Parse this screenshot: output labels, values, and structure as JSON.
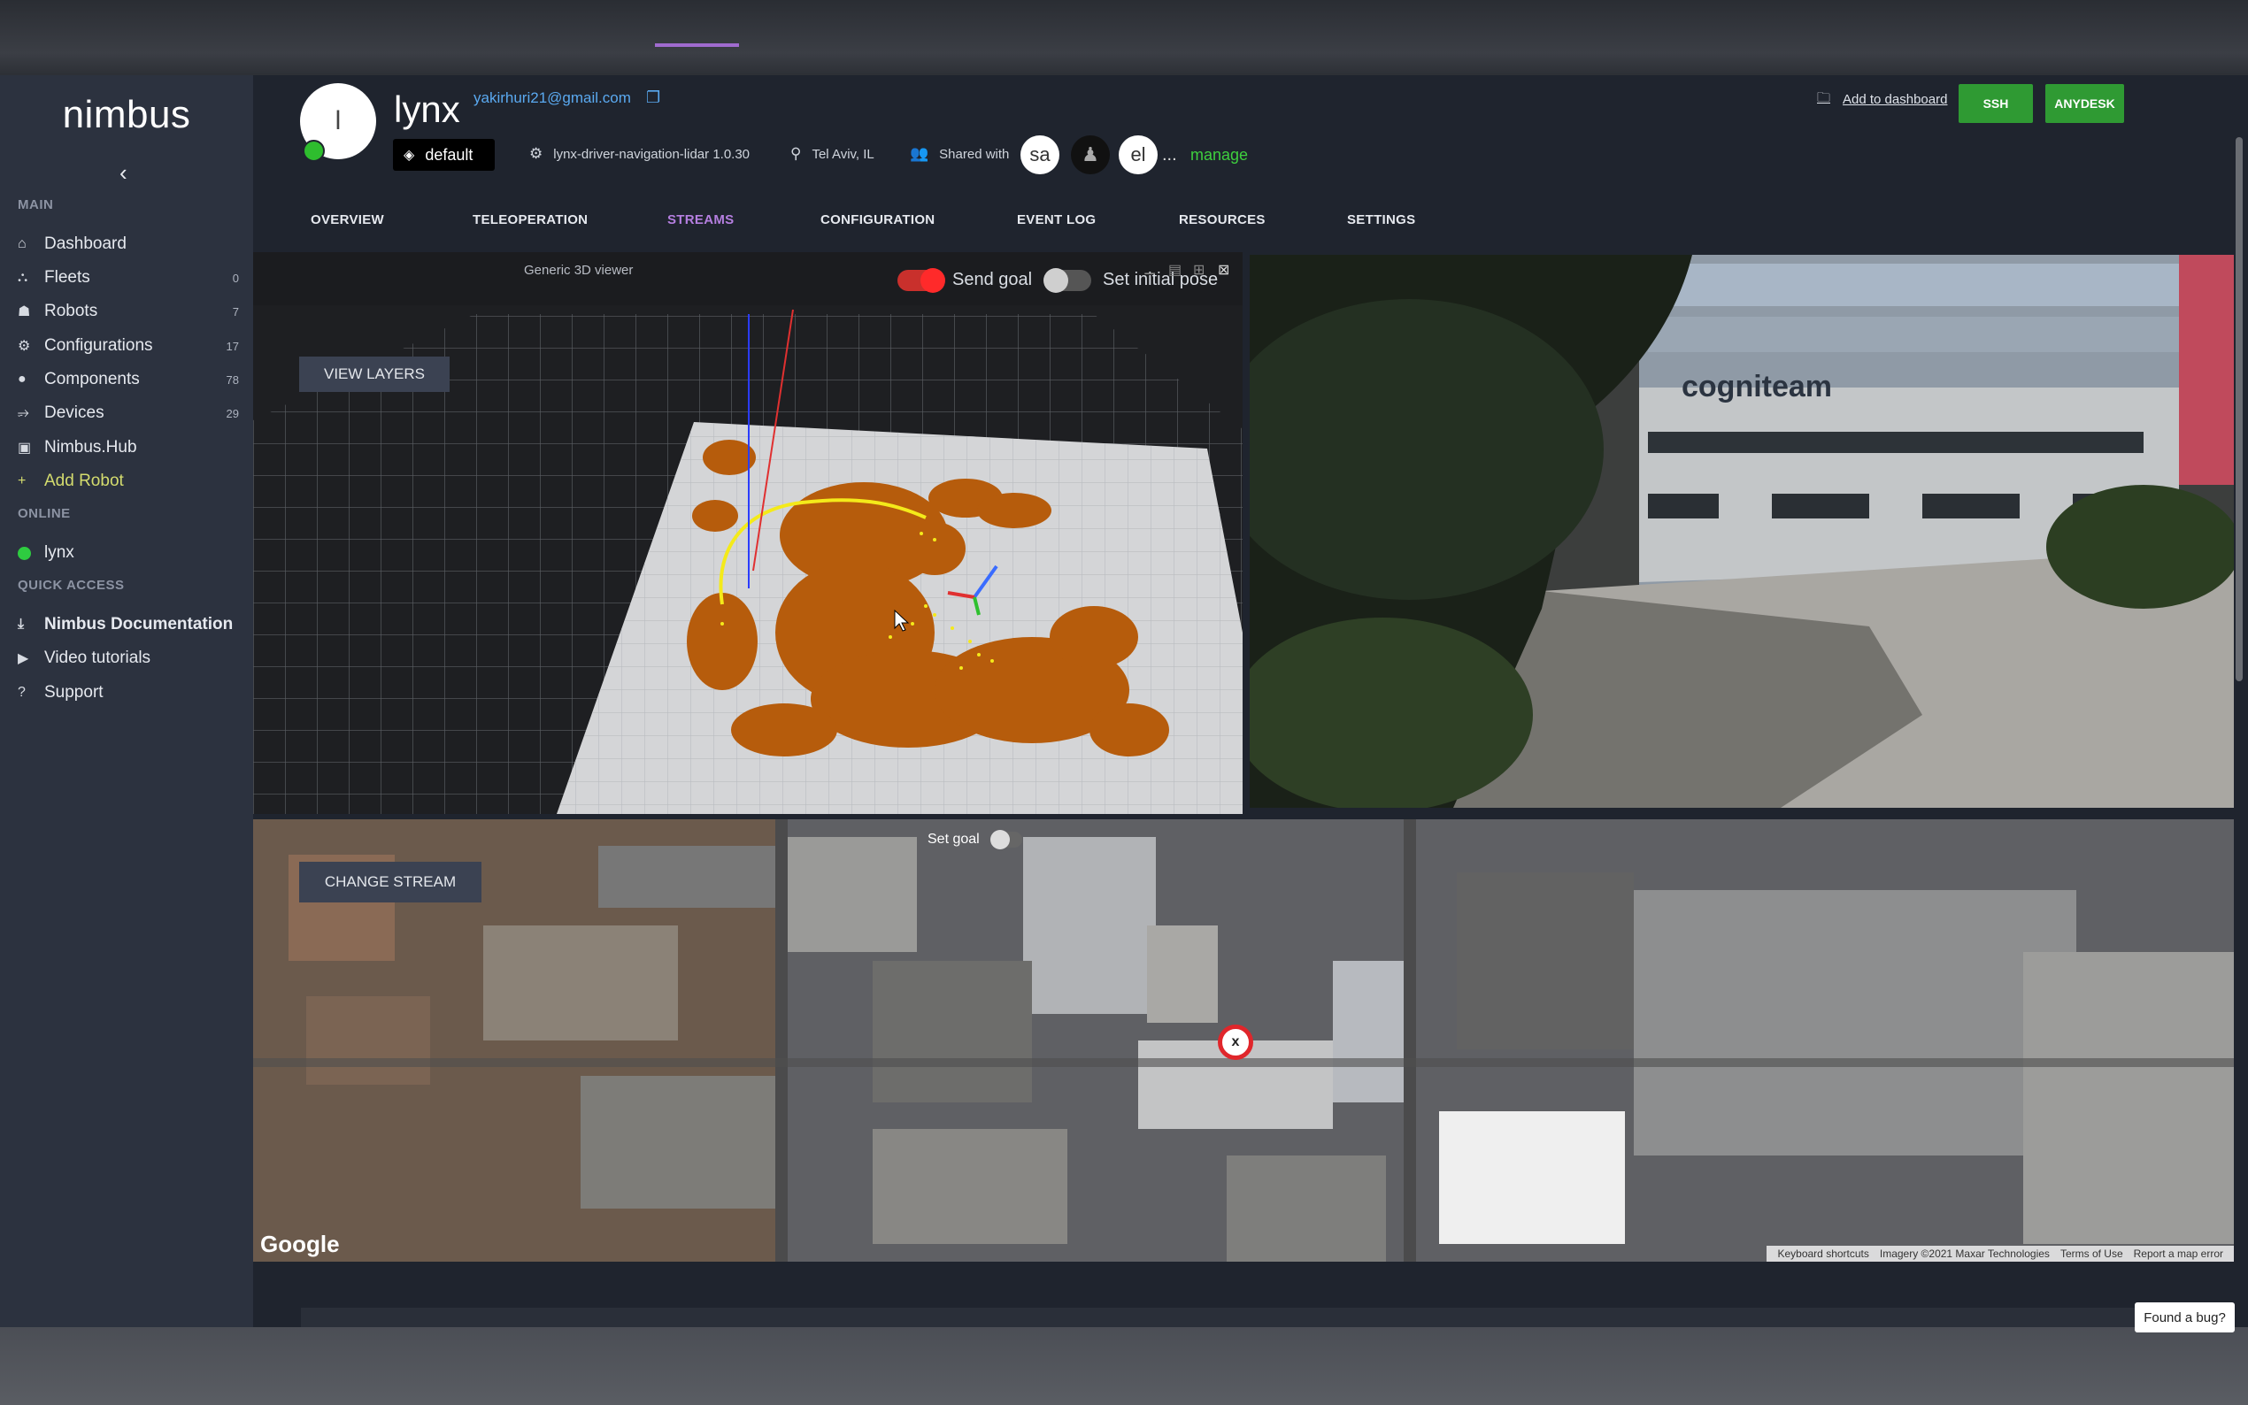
{
  "app": {
    "logo": "nimbus"
  },
  "sidebar": {
    "collapse_icon": "chevron-left-icon",
    "sections": {
      "main": "MAIN",
      "online": "ONLINE",
      "quick": "QUICK ACCESS"
    },
    "items": [
      {
        "label": "Dashboard",
        "icon": "home-icon",
        "count": ""
      },
      {
        "label": "Fleets",
        "icon": "fleet-icon",
        "count": "0"
      },
      {
        "label": "Robots",
        "icon": "robot-icon",
        "count": "7"
      },
      {
        "label": "Configurations",
        "icon": "gear-icon",
        "count": "17"
      },
      {
        "label": "Components",
        "icon": "component-icon",
        "count": "78"
      },
      {
        "label": "Devices",
        "icon": "usb-icon",
        "count": "29"
      },
      {
        "label": "Nimbus.Hub",
        "icon": "hub-icon",
        "count": ""
      },
      {
        "label": "Add Robot",
        "icon": "plus-icon",
        "count": ""
      }
    ],
    "online": [
      {
        "label": "lynx"
      }
    ],
    "quick": [
      {
        "label": "Nimbus Documentation",
        "icon": "download-icon"
      },
      {
        "label": "Video tutorials",
        "icon": "play-icon"
      },
      {
        "label": "Support",
        "icon": "help-icon"
      }
    ]
  },
  "robot": {
    "avatar_letter": "l",
    "name": "lynx",
    "email": "yakirhuri21@gmail.com",
    "config_badge": "default",
    "version": "lynx-driver-navigation-lidar 1.0.30",
    "location": "Tel Aviv, IL",
    "shared_label": "Shared with",
    "shared": [
      "sa",
      "el"
    ],
    "more": "...",
    "manage": "manage"
  },
  "actions": {
    "add_dashboard": "Add to dashboard",
    "ssh": "SSH",
    "anydesk": "ANYDESK"
  },
  "tabs": [
    "OVERVIEW",
    "TELEOPERATION",
    "STREAMS",
    "CONFIGURATION",
    "EVENT LOG",
    "RESOURCES",
    "SETTINGS"
  ],
  "active_tab": "STREAMS",
  "viewer": {
    "title": "Generic 3D viewer",
    "send_goal": "Send goal",
    "set_initial_pose": "Set initial pose",
    "view_layers": "VIEW LAYERS",
    "send_goal_on": true,
    "initial_pose_on": false
  },
  "camera": {
    "sign": "cogniteam"
  },
  "map": {
    "set_goal": "Set goal",
    "change_stream": "CHANGE STREAM",
    "marker": "x",
    "google": "Google",
    "attribution": [
      "Keyboard shortcuts",
      "Imagery ©2021 Maxar Technologies",
      "Terms of Use",
      "Report a map error"
    ]
  },
  "bug_button": "Found a bug?",
  "colors": {
    "accent": "#a06bd0",
    "green": "#2f9a33",
    "sidebar": "#2c323f",
    "main": "#1f242e",
    "map_cost": "#b65c0c"
  }
}
